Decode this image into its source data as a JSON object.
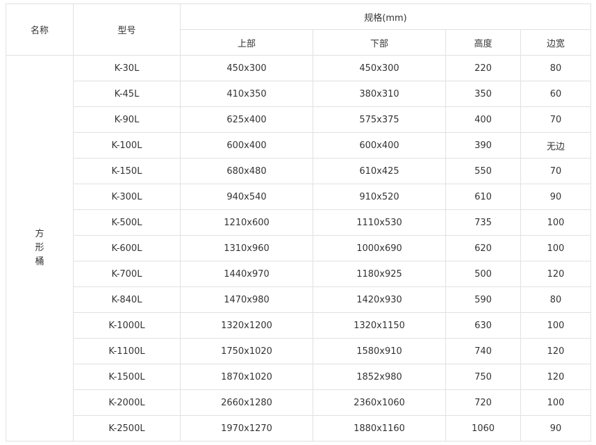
{
  "headers": {
    "name": "名称",
    "model": "型号",
    "spec": "规格(mm)",
    "top": "上部",
    "bottom": "下部",
    "height": "高度",
    "edge": "边宽"
  },
  "group_name": "方形桶",
  "rows": [
    {
      "model": "K-30L",
      "top": "450x300",
      "bottom": "450x300",
      "height": "220",
      "edge": "80"
    },
    {
      "model": "K-45L",
      "top": "410x350",
      "bottom": "380x310",
      "height": "350",
      "edge": "60"
    },
    {
      "model": "K-90L",
      "top": "625x400",
      "bottom": "575x375",
      "height": "400",
      "edge": "70"
    },
    {
      "model": "K-100L",
      "top": "600x400",
      "bottom": "600x400",
      "height": "390",
      "edge": "无边"
    },
    {
      "model": "K-150L",
      "top": "680x480",
      "bottom": "610x425",
      "height": "550",
      "edge": "70"
    },
    {
      "model": "K-300L",
      "top": "940x540",
      "bottom": "910x520",
      "height": "610",
      "edge": "90"
    },
    {
      "model": "K-500L",
      "top": "1210x600",
      "bottom": "1110x530",
      "height": "735",
      "edge": "100"
    },
    {
      "model": "K-600L",
      "top": "1310x960",
      "bottom": "1000x690",
      "height": "620",
      "edge": "100"
    },
    {
      "model": "K-700L",
      "top": "1440x970",
      "bottom": "1180x925",
      "height": "500",
      "edge": "120"
    },
    {
      "model": "K-840L",
      "top": "1470x980",
      "bottom": "1420x930",
      "height": "590",
      "edge": "80"
    },
    {
      "model": "K-1000L",
      "top": "1320x1200",
      "bottom": "1320x1150",
      "height": "630",
      "edge": "100"
    },
    {
      "model": "K-1100L",
      "top": "1750x1020",
      "bottom": "1580x910",
      "height": "740",
      "edge": "120"
    },
    {
      "model": "K-1500L",
      "top": "1870x1020",
      "bottom": "1852x980",
      "height": "750",
      "edge": "120"
    },
    {
      "model": "K-2000L",
      "top": "2660x1280",
      "bottom": "2360x1060",
      "height": "720",
      "edge": "100"
    },
    {
      "model": "K-2500L",
      "top": "1970x1270",
      "bottom": "1880x1160",
      "height": "1060",
      "edge": "90"
    }
  ]
}
